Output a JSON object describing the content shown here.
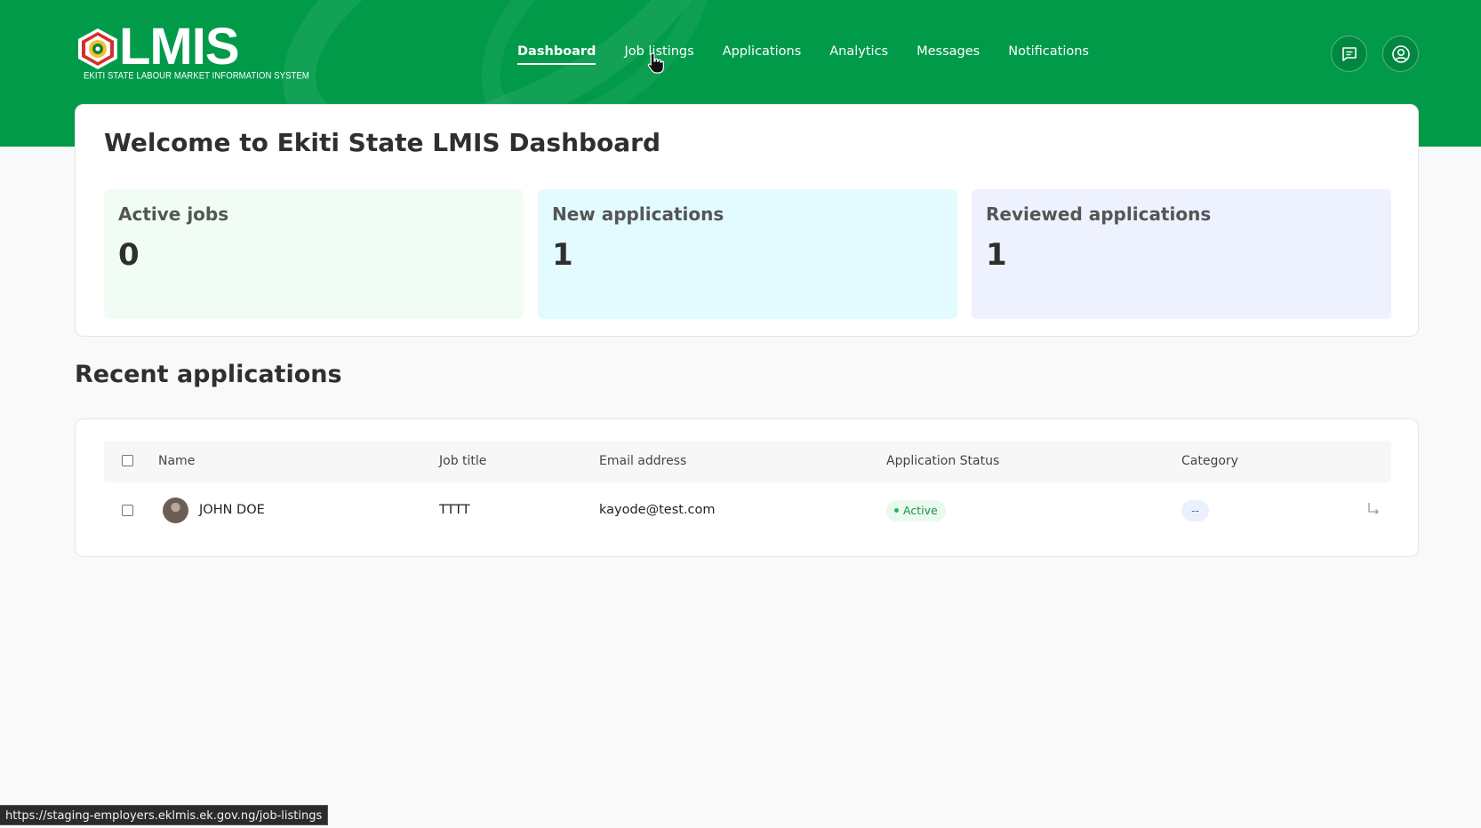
{
  "header": {
    "logo_text": "LMIS",
    "logo_subtitle": "EKITI STATE LABOUR MARKET INFORMATION SYSTEM",
    "nav": [
      {
        "label": "Dashboard",
        "active": true
      },
      {
        "label": "Job listings",
        "active": false
      },
      {
        "label": "Applications",
        "active": false
      },
      {
        "label": "Analytics",
        "active": false
      },
      {
        "label": "Messages",
        "active": false
      },
      {
        "label": "Notifications",
        "active": false
      }
    ],
    "icons": [
      "chat-icon",
      "user-circle-icon"
    ],
    "brand_color": "#009a49"
  },
  "welcome": {
    "title": "Welcome to Ekiti State LMIS Dashboard",
    "stats": [
      {
        "label": "Active jobs",
        "value": "0",
        "color": "#f1fdf4"
      },
      {
        "label": "New applications",
        "value": "1",
        "color": "#e3fbfe"
      },
      {
        "label": "Reviewed applications",
        "value": "1",
        "color": "#eef2fe"
      }
    ]
  },
  "recent": {
    "title": "Recent applications",
    "columns": [
      "Name",
      "Job title",
      "Email address",
      "Application Status",
      "Category"
    ],
    "rows": [
      {
        "name": "JOHN DOE",
        "job_title": "TTTT",
        "email": "kayode@test.com",
        "status": "Active",
        "category": "--"
      }
    ]
  },
  "statusbar": {
    "url": "https://staging-employers.eklmis.ek.gov.ng/job-listings"
  }
}
